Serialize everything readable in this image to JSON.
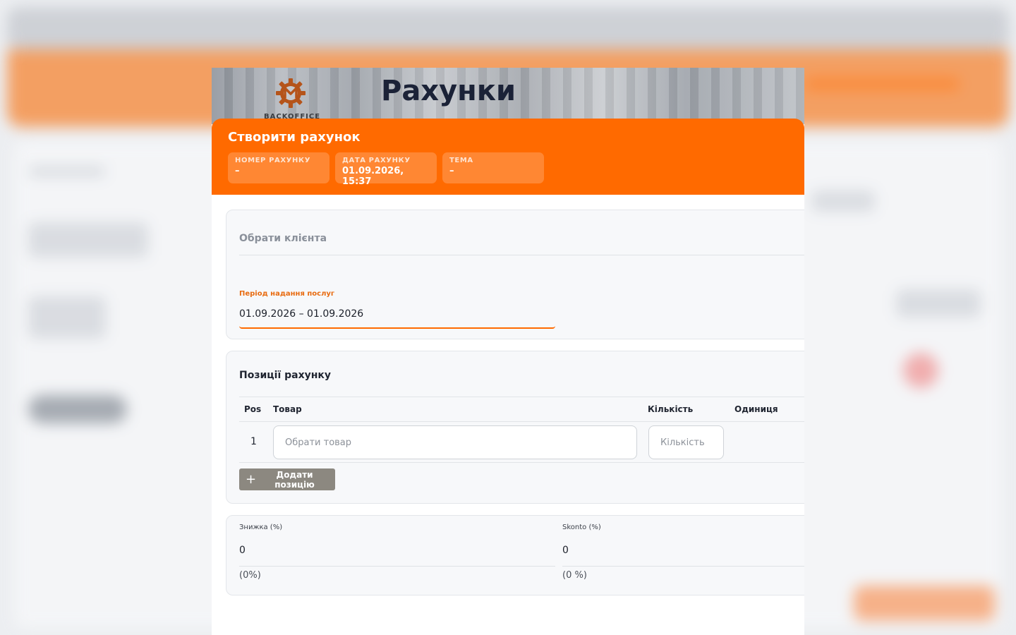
{
  "page": {
    "title": "Рахунки",
    "logo_caption": "BACKOFFICE"
  },
  "modal": {
    "title": "Створити рахунок",
    "chips": [
      {
        "label": "НОМЕР РАХУНКУ",
        "value": "–"
      },
      {
        "label": "ДАТА РАХУНКУ",
        "value": "01.09.2026, 15:37"
      },
      {
        "label": "ТЕМА",
        "value": "–"
      }
    ]
  },
  "client": {
    "placeholder": "Обрати клієнта"
  },
  "period": {
    "label": "Період надання послуг",
    "value": "01.09.2026 – 01.09.2026"
  },
  "positions": {
    "title": "Позиції рахунку",
    "columns": [
      "Pos",
      "Товар",
      "Кількість",
      "Одиниця"
    ],
    "rows": [
      {
        "pos": "1",
        "product_placeholder": "Обрати товар",
        "qty_placeholder": "Кількість"
      }
    ],
    "add_label": "Додати позицію"
  },
  "discount": {
    "label": "Знижка (%)",
    "value": "0",
    "hint": "(0%)"
  },
  "skonto": {
    "label": "Skonto (%)",
    "value": "0",
    "hint": "(0 %)"
  },
  "colors": {
    "accent": "#ff6a00",
    "title_dark": "#1b2237",
    "add_button": "#8c8880"
  }
}
